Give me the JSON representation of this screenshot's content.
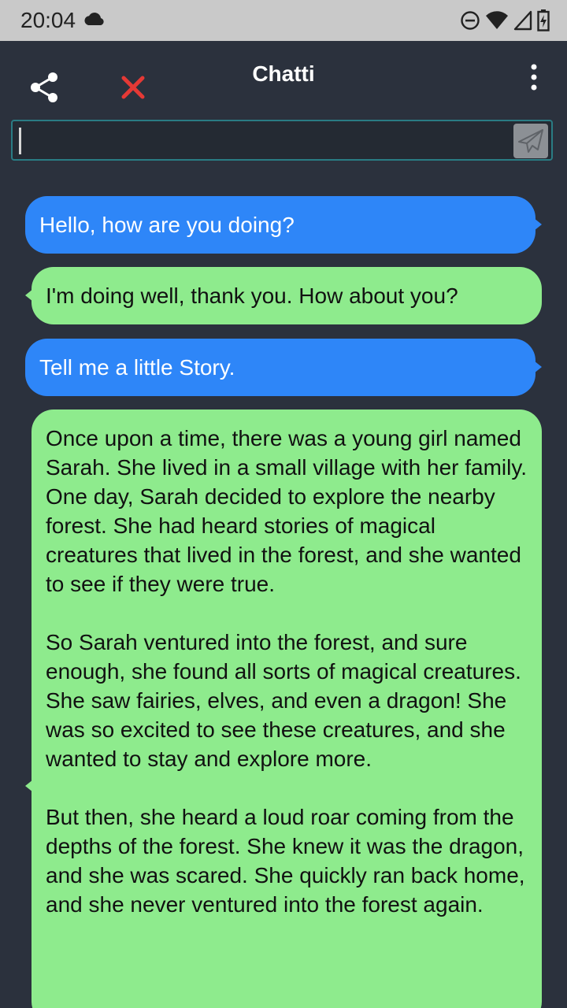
{
  "status_bar": {
    "time": "20:04",
    "icons": [
      "cloud-icon",
      "do-not-disturb-icon",
      "wifi-icon",
      "signal-icon",
      "battery-charging-icon"
    ]
  },
  "app_bar": {
    "title": "Chatti",
    "icons": [
      "share-icon",
      "close-icon",
      "more-vert-icon"
    ],
    "colors": {
      "close": "#e53935",
      "background": "#2b313d"
    }
  },
  "composer": {
    "value": "",
    "placeholder": "",
    "send_icon": "send-icon"
  },
  "colors": {
    "user_bubble": "#2e86f8",
    "bot_bubble": "#8eeb8d",
    "background": "#2b313d"
  },
  "messages": [
    {
      "role": "user",
      "text": "Hello, how are you doing?"
    },
    {
      "role": "bot",
      "text": "I'm doing well, thank you. How about you?"
    },
    {
      "role": "user",
      "text": "Tell me a little Story."
    },
    {
      "role": "bot",
      "text": "Once upon a time, there was a young girl named Sarah. She lived in a small village with her family. One day, Sarah decided to explore the nearby forest. She had heard stories of magical creatures that lived in the forest, and she wanted to see if they were true.\n\nSo Sarah ventured into the forest, and sure enough, she found all sorts of magical creatures. She saw fairies, elves, and even a dragon! She was so excited to see these creatures, and she wanted to stay and explore more.\n\nBut then, she heard a loud roar coming from the depths of the forest. She knew it was the dragon, and she was scared. She quickly ran back home, and she never ventured into the forest again."
    }
  ]
}
